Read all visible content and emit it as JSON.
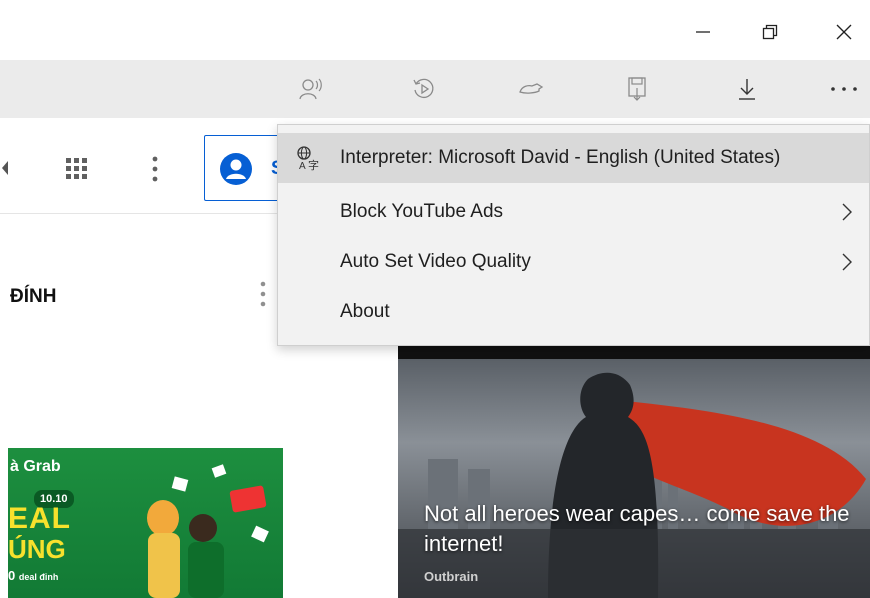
{
  "window": {
    "controls": [
      "minimize",
      "restore",
      "close"
    ]
  },
  "toolbar": {
    "icons": [
      "read-aloud-icon",
      "history-icon",
      "extension-icon",
      "save-page-icon",
      "download-icon",
      "more-icon"
    ]
  },
  "youtube": {
    "signin_partial": "S",
    "section_title": "ĐÍNH"
  },
  "grab_ad": {
    "brand": "à Grab",
    "date": "10.10",
    "line1": "EAL",
    "line2": "ÚNG",
    "line3_num": "0",
    "line3_text": "deal đỉnh"
  },
  "outbrain_ad": {
    "headline": "Not all heroes wear capes… come save the internet!",
    "source": "Outbrain"
  },
  "menu": {
    "items": [
      {
        "label": "Interpreter: Microsoft David - English (United States)",
        "has_submenu": false,
        "icon": "translate-icon"
      },
      {
        "label": "Block YouTube Ads",
        "has_submenu": true
      },
      {
        "label": "Auto Set Video Quality",
        "has_submenu": true
      },
      {
        "label": "About",
        "has_submenu": false
      }
    ]
  },
  "colors": {
    "toolbar_bg": "#ebebeb",
    "menu_bg": "#f2f2f2",
    "menu_hover": "#d9d9d9",
    "youtube_blue": "#065fd4",
    "grab_green": "#1d8f3f"
  }
}
